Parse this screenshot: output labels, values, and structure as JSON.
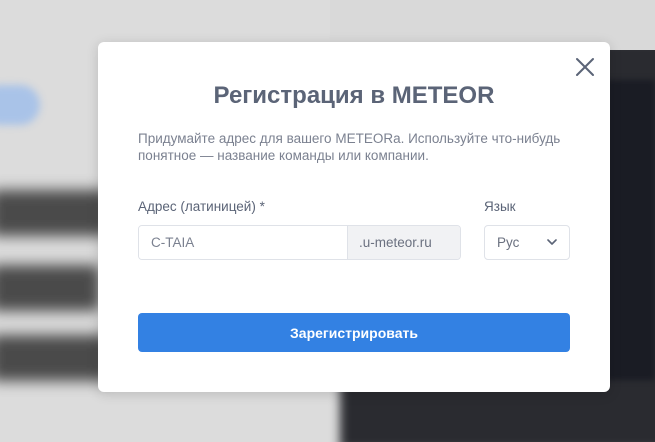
{
  "modal": {
    "title": "Регистрация в METEOR",
    "description": "Придумайте адрес для вашего METEORа. Используйте что-нибудь понятное — название команды или компании.",
    "address_label": "Адрес (латиницей) *",
    "address_placeholder": "C-TAIA",
    "address_value": "",
    "address_suffix": ".u-meteor.ru",
    "language_label": "Язык",
    "language_selected": "Рус",
    "submit_label": "Зарегистрировать",
    "close_icon": "close-icon",
    "chevron_icon": "chevron-down-icon"
  },
  "colors": {
    "title": "#5b6477",
    "text": "#7b8190",
    "accent": "#3381e3",
    "suffix_bg": "#f1f2f4",
    "border": "#dfe2e8"
  }
}
